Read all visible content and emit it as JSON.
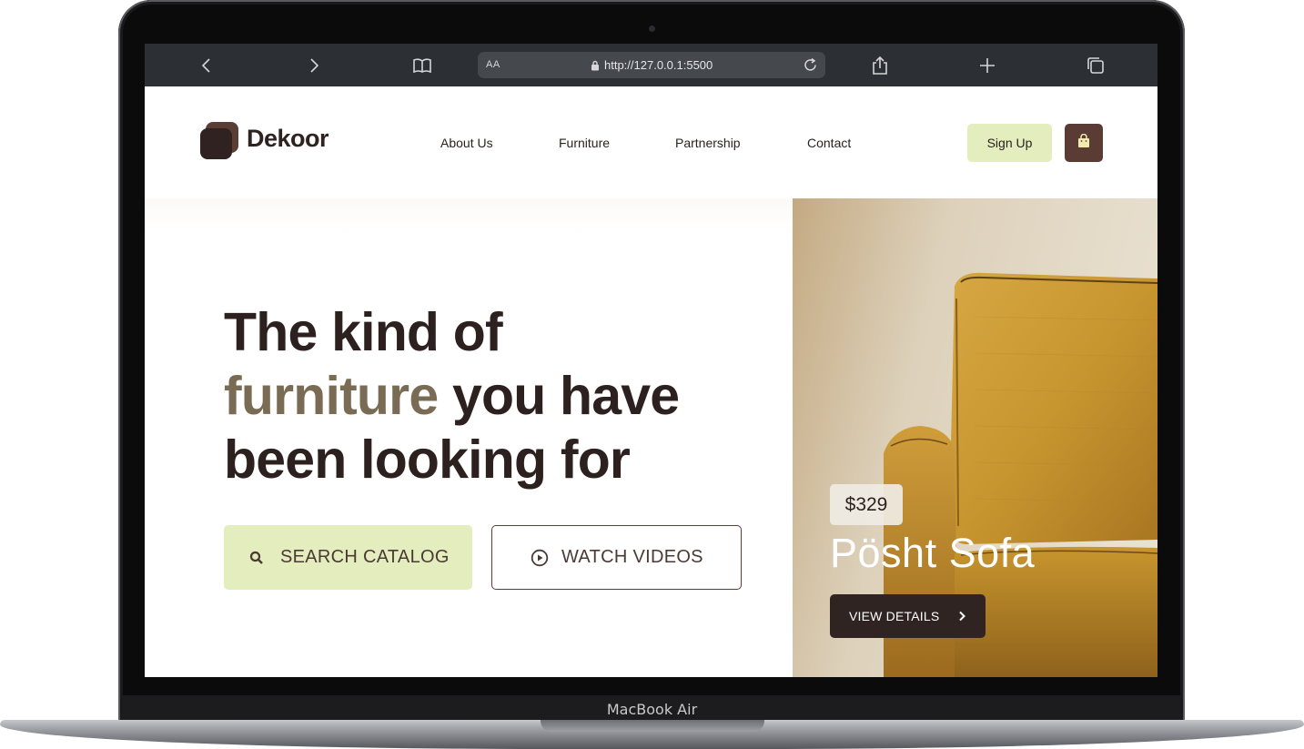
{
  "device": {
    "model_label": "MacBook Air"
  },
  "browser": {
    "address_prefix": "AA",
    "url": "http://127.0.0.1:5500"
  },
  "site": {
    "brand": "Dekoor",
    "nav": [
      {
        "label": "About Us"
      },
      {
        "label": "Furniture"
      },
      {
        "label": "Partnership"
      },
      {
        "label": "Contact"
      }
    ],
    "signup_label": "Sign Up"
  },
  "hero": {
    "headline_part1": "The kind of",
    "headline_accent": "furniture",
    "headline_part2": "you have been looking for",
    "search_button": "SEARCH CATALOG",
    "watch_button": "WATCH VIDEOS"
  },
  "product": {
    "price": "$329",
    "name": "Pösht Sofa",
    "details_button": "VIEW DETAILS"
  },
  "colors": {
    "brand_dark": "#2f2220",
    "brand_brown": "#5a3c35",
    "accent_lime": "#e4edbd",
    "headline_accent": "#7a6b54",
    "sofa_mustard": "#c8962f"
  },
  "icons": {
    "browser": [
      "back-icon",
      "forward-icon",
      "bookmarks-icon",
      "lock-icon",
      "reload-icon",
      "share-icon",
      "new-tab-icon",
      "tabs-icon"
    ],
    "site": [
      "logo-icon",
      "shopping-bag-icon",
      "search-icon",
      "play-circle-icon",
      "chevron-right-icon"
    ]
  }
}
